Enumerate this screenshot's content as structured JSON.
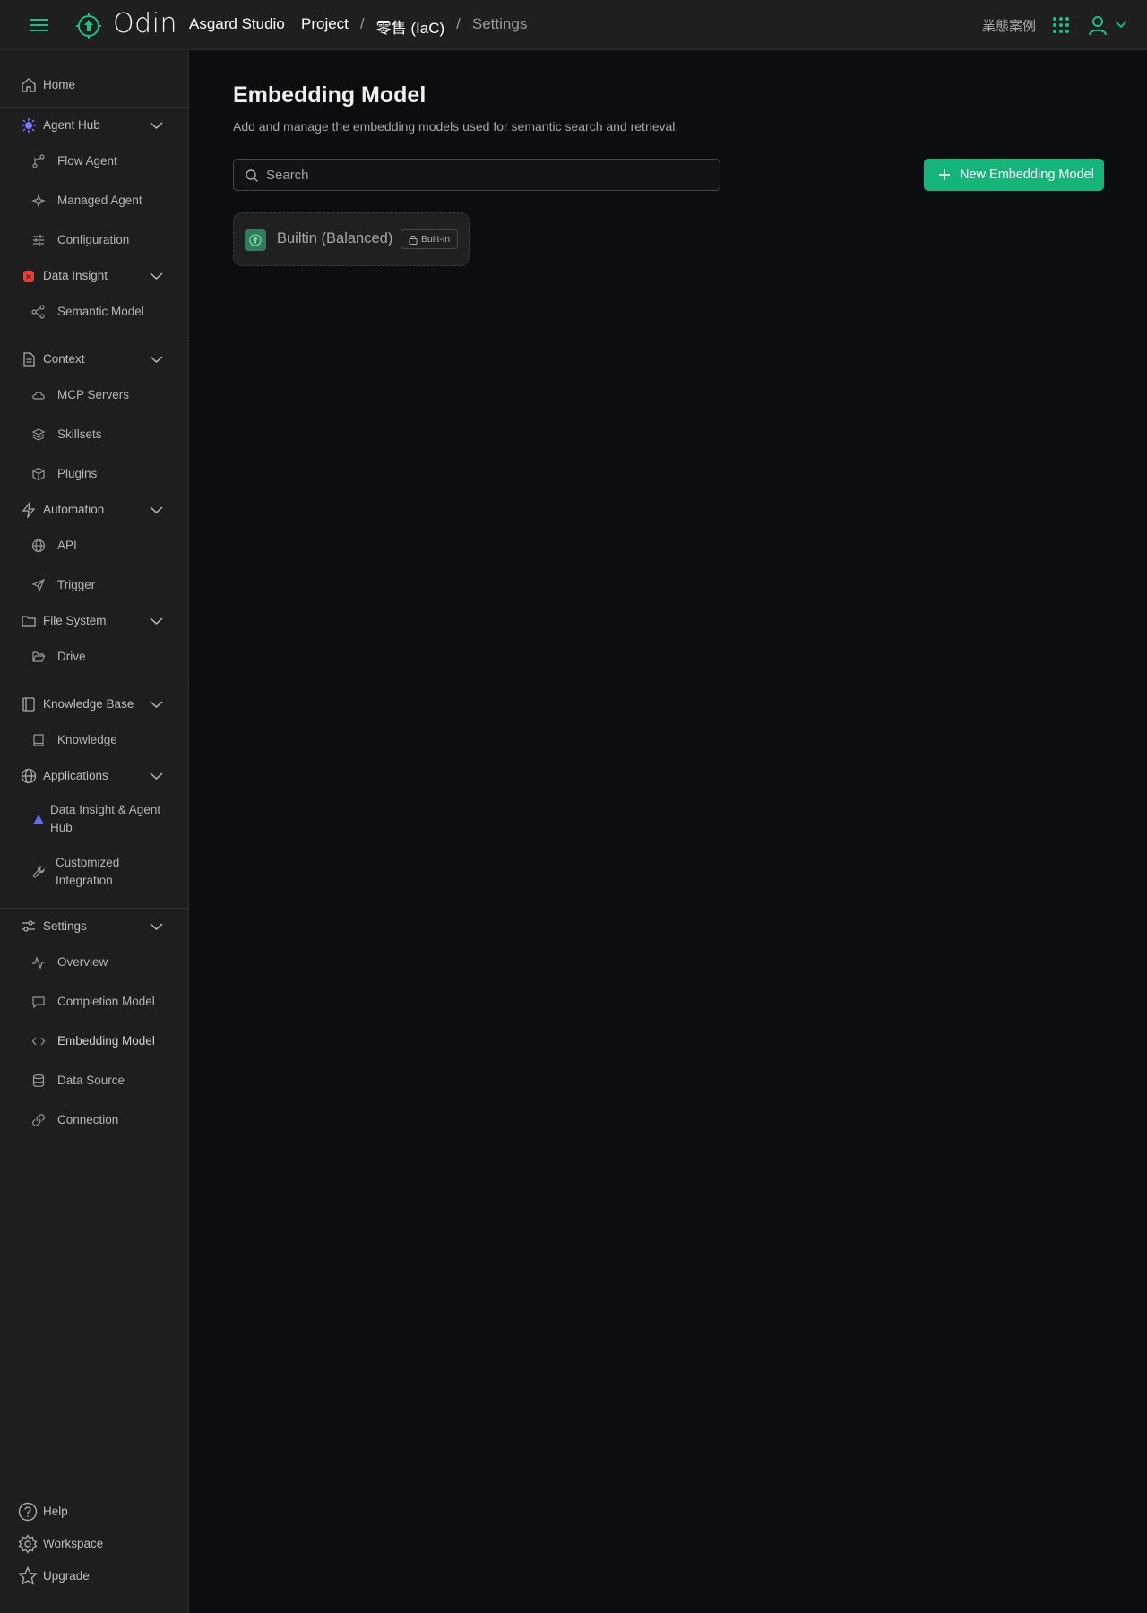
{
  "topbar": {
    "brand": "Odin",
    "studio": "Asgard Studio",
    "breadcrumbs": [
      "Project",
      "零售 (IaC)",
      "Settings"
    ],
    "case_link": "業態案例"
  },
  "sidebar": {
    "home": "Home",
    "agent_hub": {
      "label": "Agent Hub",
      "items": [
        "Flow Agent",
        "Managed Agent",
        "Configuration"
      ]
    },
    "data_insight": {
      "label": "Data Insight",
      "items": [
        "Semantic Model"
      ]
    },
    "context": {
      "label": "Context",
      "items": [
        "MCP Servers",
        "Skillsets",
        "Plugins"
      ]
    },
    "automation": {
      "label": "Automation",
      "items": [
        "API",
        "Trigger"
      ]
    },
    "file_system": {
      "label": "File System",
      "items": [
        "Drive"
      ]
    },
    "knowledge_base": {
      "label": "Knowledge Base",
      "items": [
        "Knowledge"
      ]
    },
    "applications": {
      "label": "Applications",
      "items": [
        "Data Insight & Agent Hub",
        "Customized Integration"
      ]
    },
    "settings": {
      "label": "Settings",
      "items": [
        "Overview",
        "Completion Model",
        "Embedding Model",
        "Data Source",
        "Connection"
      ]
    },
    "footer": [
      "Help",
      "Workspace",
      "Upgrade"
    ]
  },
  "main": {
    "title": "Embedding Model",
    "subtitle": "Add and manage the embedding models used for semantic search and retrieval.",
    "search_placeholder": "Search",
    "new_button": "New Embedding Model",
    "models": [
      {
        "name": "Builtin (Balanced)",
        "badge": "Built-in"
      }
    ]
  },
  "colors": {
    "accent": "#15b57a",
    "background": "#0c0d11",
    "sidebar": "#1e1e1e",
    "topbar": "#1f1f1f"
  }
}
